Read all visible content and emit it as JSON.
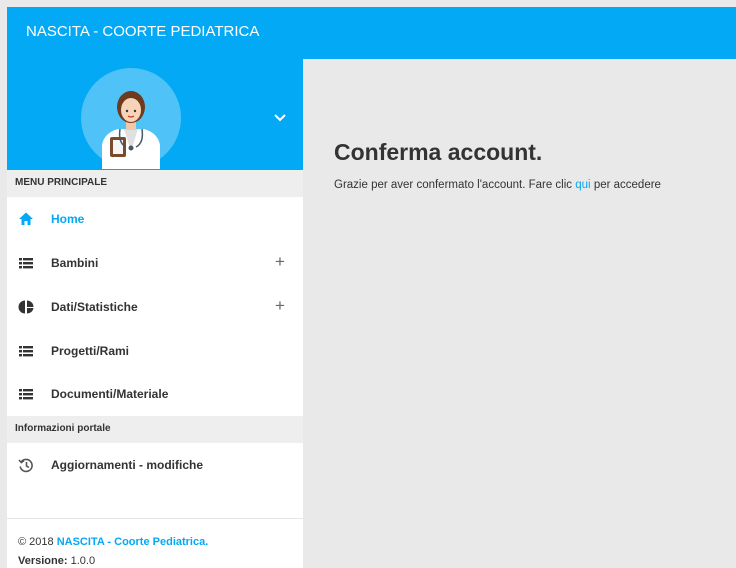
{
  "header": {
    "title": "NASCITA - COORTE PEDIATRICA"
  },
  "sidebar": {
    "section_main": "MENU PRINCIPALE",
    "items": [
      {
        "label": "Home",
        "icon": "home-icon"
      },
      {
        "label": "Bambini",
        "icon": "list-icon",
        "expand": "+"
      },
      {
        "label": "Dati/Statistiche",
        "icon": "pie-chart-icon",
        "expand": "+"
      },
      {
        "label": "Progetti/Rami",
        "icon": "list-icon"
      },
      {
        "label": "Documenti/Materiale",
        "icon": "list-icon"
      }
    ],
    "section_info": "Informazioni portale",
    "info_items": [
      {
        "label": "Aggiornamenti - modifiche",
        "icon": "history-icon"
      }
    ],
    "footer": {
      "copyright": "© 2018",
      "brand": "NASCITA - Coorte Pediatrica.",
      "version_label": "Versione:",
      "version": "1.0.0"
    }
  },
  "main": {
    "title": "Conferma account.",
    "message_before": "Grazie per aver confermato l'account. Fare clic",
    "link": "qui",
    "message_after": "per accedere"
  },
  "colors": {
    "accent": "#03a9f4",
    "background": "#e9e9e9",
    "sidebar": "#ffffff",
    "section": "#eeeeee"
  }
}
